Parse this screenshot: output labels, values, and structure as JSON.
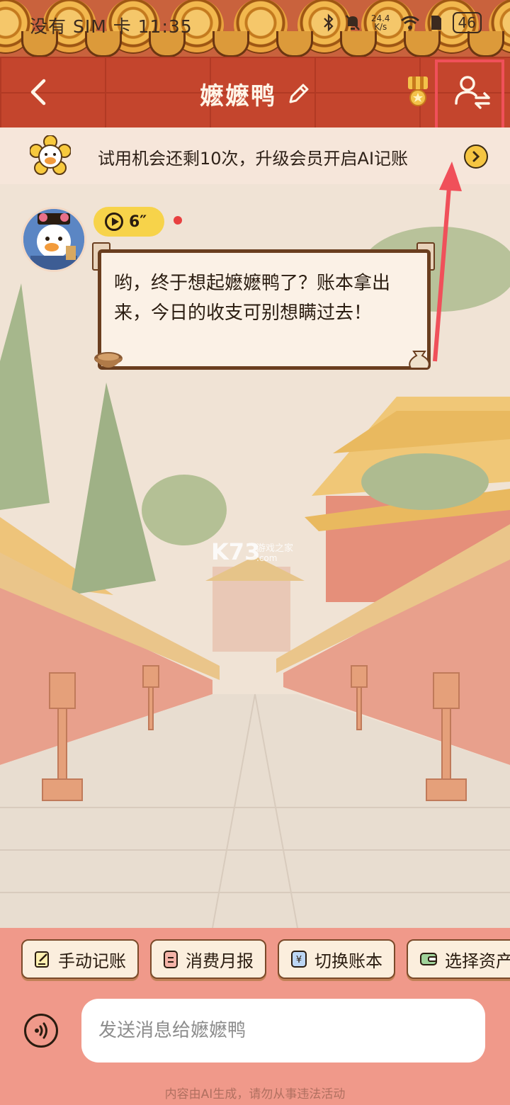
{
  "status_bar": {
    "left": "没有 SIM 卡 11:35",
    "net_speed_value": "24.4",
    "net_speed_unit": "K/s",
    "battery": "46"
  },
  "header": {
    "title": "嬷嬷鸭"
  },
  "promo": {
    "text": "试用机会还剩10次，升级会员开启AI记账"
  },
  "chat": {
    "voice_duration": "6″",
    "message": "哟，终于想起嬷嬷鸭了？账本拿出来，今日的收支可别想瞒过去！"
  },
  "watermark": {
    "brand": "K73",
    "subtitle": "游戏之家",
    "domain": ".com"
  },
  "quick_actions": [
    {
      "label": "手动记账"
    },
    {
      "label": "消费月报"
    },
    {
      "label": "切换账本"
    },
    {
      "label": "选择资产"
    }
  ],
  "input": {
    "placeholder": "发送消息给嬷嬷鸭"
  },
  "footer": {
    "note": "内容由AI生成，请勿从事违法活动"
  },
  "colors": {
    "nav_red": "#c4452d",
    "accent_yellow": "#f7d34a",
    "bottom_panel": "#f0998a",
    "highlight": "#f0505a"
  }
}
